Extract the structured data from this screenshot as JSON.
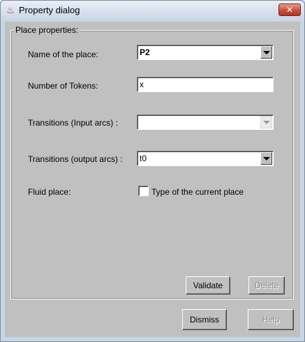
{
  "window": {
    "title": "Property dialog",
    "close_glyph": "✕",
    "app_icon": "java-coffee-cup-icon"
  },
  "group": {
    "title": "Place properties:"
  },
  "fields": {
    "name_label": "Name of the place:",
    "name_value": "P2",
    "tokens_label": "Number of Tokens:",
    "tokens_value": "x",
    "input_arcs_label": "Transitions (Input arcs) :",
    "input_arcs_value": "",
    "output_arcs_label": "Transitions (output arcs) :",
    "output_arcs_value": "t0",
    "fluid_label": "Fluid place:",
    "fluid_checkbox_label": "Type of the current place",
    "fluid_checked": false
  },
  "buttons": {
    "validate": "Validate",
    "delete": "Delete",
    "dismiss": "Dismiss",
    "help": "Help"
  }
}
